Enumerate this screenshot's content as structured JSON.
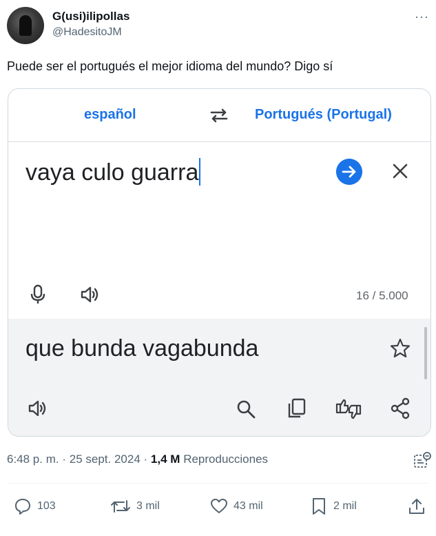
{
  "author": {
    "display_name": "G(usi)ilipollas",
    "handle": "@HadesitoJM"
  },
  "more_label": "···",
  "tweet_text": "Puede ser el portugués el mejor idioma del mundo? Digo sí",
  "translate_card": {
    "source_language": "español",
    "target_language": "Portugués (Portugal)",
    "source_text": "vaya culo guarra",
    "char_counter": "16 / 5.000",
    "translated_text": "que bunda vagabunda"
  },
  "meta": {
    "time": "6:48 p. m.",
    "separator": "·",
    "date": "25 sept. 2024",
    "views_count": "1,4 M",
    "views_label": "Reproducciones"
  },
  "actions": {
    "replies": "103",
    "reposts": "3 mil",
    "likes": "43 mil",
    "bookmarks": "2 mil"
  },
  "colors": {
    "accent_blue": "#1a73e8",
    "text_primary": "#0f1419",
    "text_secondary": "#536471",
    "translation_bg": "#f1f3f4"
  }
}
